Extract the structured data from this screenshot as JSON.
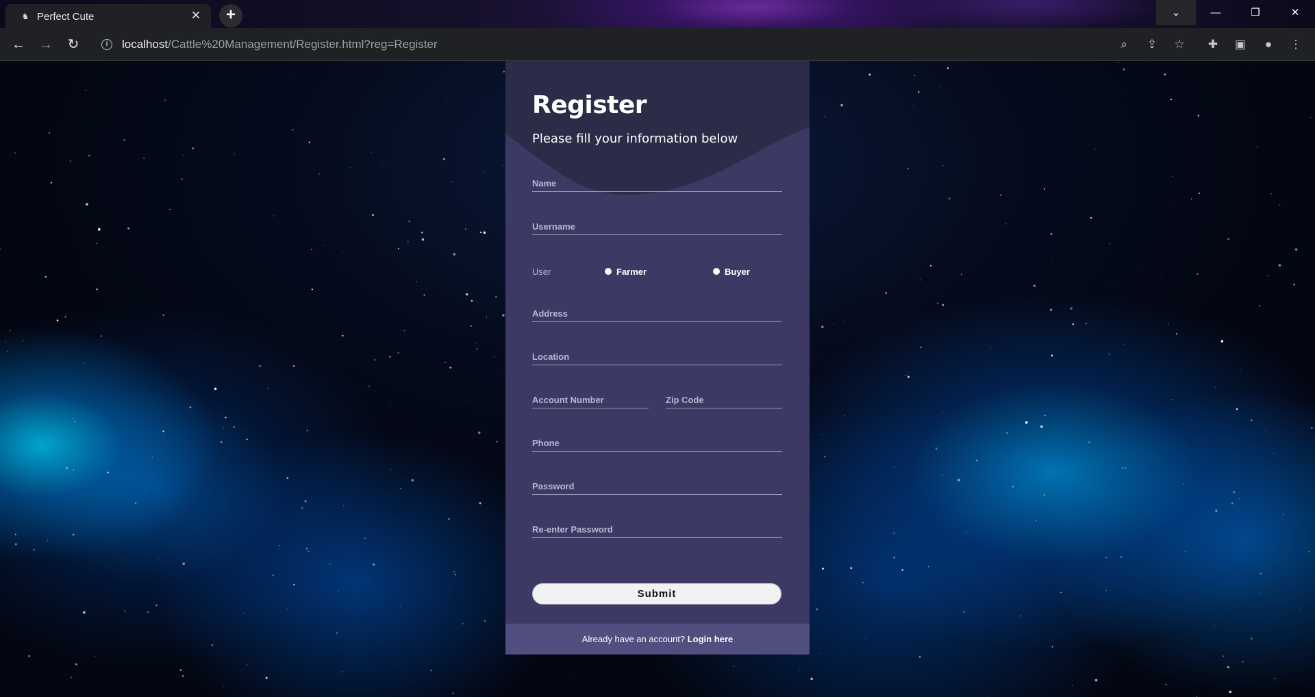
{
  "browser": {
    "tab_title": "Perfect Cute",
    "url_host": "localhost",
    "url_path": "/Cattle%20Management/Register.html?reg=Register"
  },
  "form": {
    "title": "Register",
    "subtitle": "Please fill your information below",
    "fields": {
      "name": "Name",
      "username": "Username",
      "address": "Address",
      "location": "Location",
      "account_number": "Account Number",
      "zip_code": "Zip Code",
      "phone": "Phone",
      "password": "Password",
      "reenter_password": "Re-enter Password"
    },
    "user_type": {
      "label": "User",
      "options": [
        "Farmer",
        "Buyer"
      ]
    },
    "submit_label": "Submit",
    "footer_text": "Already have an account?",
    "login_link": "Login here"
  },
  "colors": {
    "card_bg": "#3c3a65",
    "card_header": "#2b2c48",
    "card_footer": "#514e80"
  }
}
